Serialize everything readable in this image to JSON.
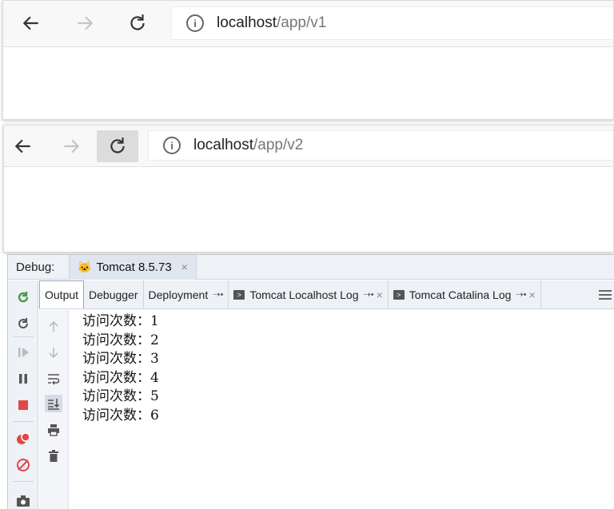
{
  "browser1": {
    "url_host": "localhost",
    "url_path": "/app/v1",
    "icons": {
      "back": "arrow-left-icon",
      "forward": "arrow-right-icon",
      "reload": "reload-icon",
      "info": "info-icon"
    }
  },
  "browser2": {
    "url_host": "localhost",
    "url_path": "/app/v2",
    "icons": {
      "back": "arrow-left-icon",
      "forward": "arrow-right-icon",
      "reload": "reload-icon",
      "info": "info-icon"
    }
  },
  "ide": {
    "debug_label": "Debug:",
    "run_tab": {
      "label": "Tomcat 8.5.73",
      "icon": "tomcat-icon"
    },
    "tabs": [
      {
        "label": "Output",
        "active": true
      },
      {
        "label": "Debugger",
        "active": false
      },
      {
        "label": "Deployment",
        "active": false
      },
      {
        "label": "Tomcat Localhost Log",
        "active": false
      },
      {
        "label": "Tomcat Catalina Log",
        "active": false
      }
    ],
    "console_lines": [
      "访问次数：1",
      "访问次数：2",
      "访问次数：3",
      "访问次数：4",
      "访问次数：5",
      "访问次数：6"
    ],
    "colors": {
      "rerun": "#4a9a4a",
      "stop": "#e04848",
      "mute": "#e04848"
    }
  }
}
